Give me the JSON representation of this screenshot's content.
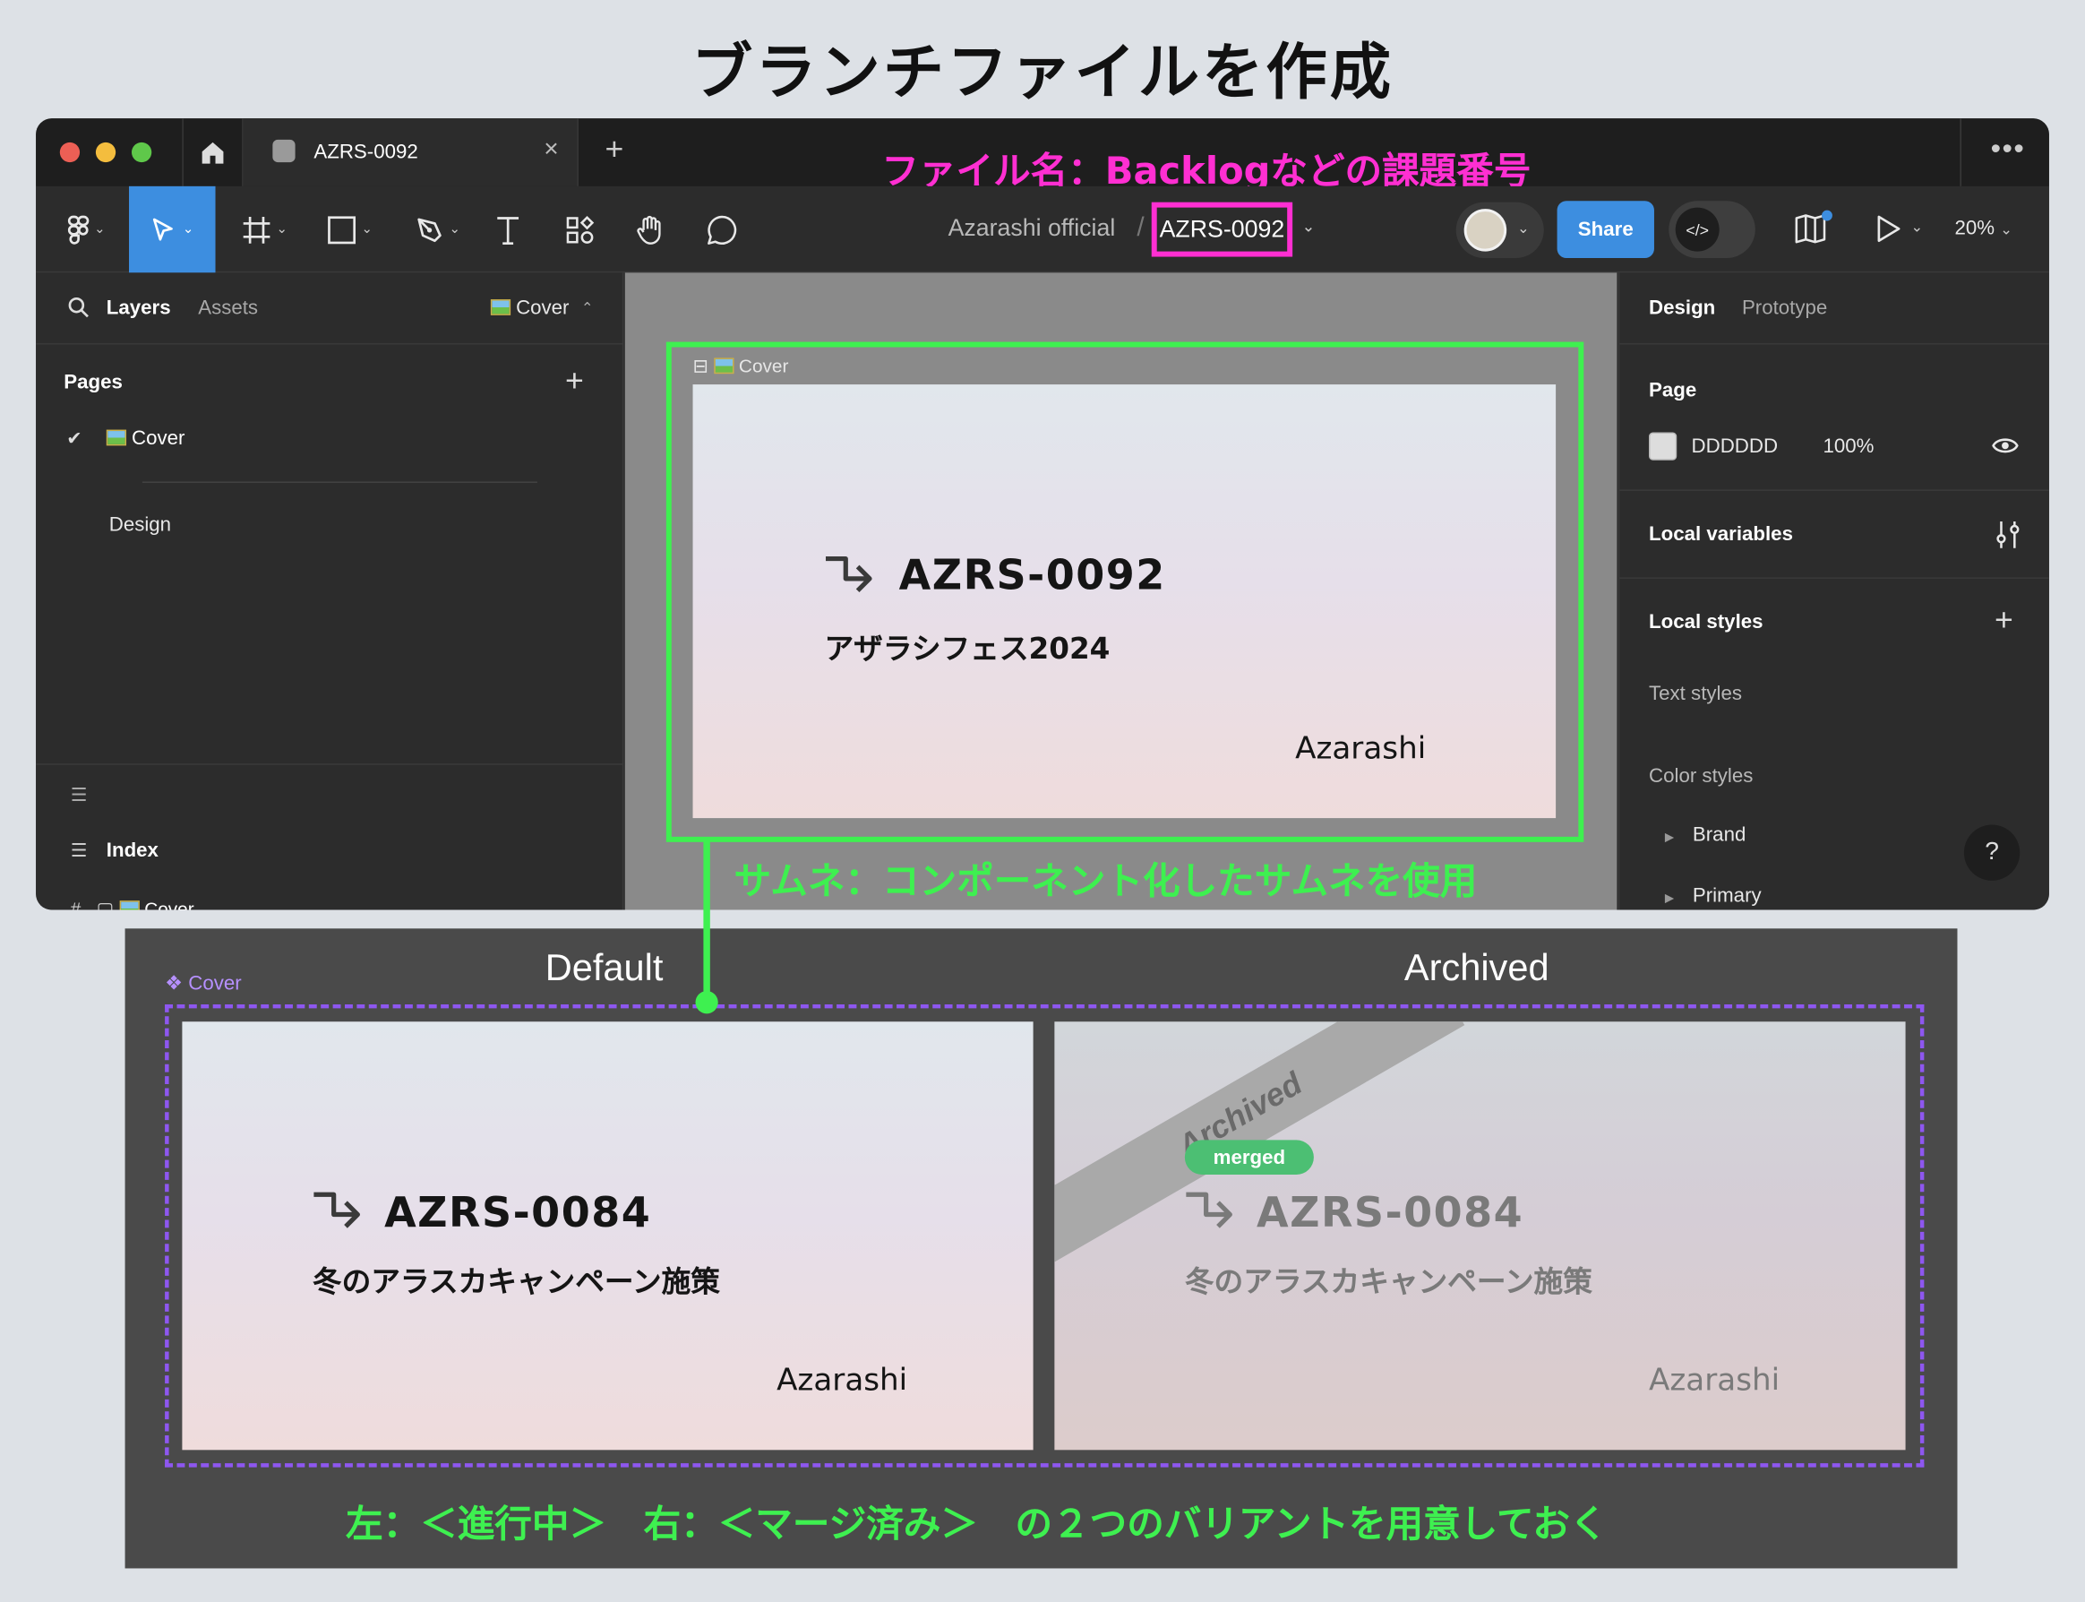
{
  "heading": "ブランチファイルを作成",
  "annotations": {
    "file_name": "ファイル名：Backlogなどの課題番号",
    "thumbnail": "サムネ：コンポーネント化したサムネを使用",
    "variants": "左：＜進行中＞　右：＜マージ済み＞　の２つのバリアントを用意しておく"
  },
  "titlebar": {
    "tab_label": "AZRS-0092",
    "tab_close": "×",
    "new_tab": "+",
    "more": "•••"
  },
  "toolbar": {
    "team": "Azarashi official",
    "separator": "/",
    "file_name": "AZRS-0092",
    "share_label": "Share",
    "dev_mode_icon": "</>",
    "zoom": "20%"
  },
  "left_panel": {
    "layers_tab": "Layers",
    "assets_tab": "Assets",
    "current_page": "Cover",
    "pages_heading": "Pages",
    "add": "+",
    "pages": [
      {
        "label": "Cover",
        "active": true
      },
      {
        "label": "Design",
        "active": false
      }
    ],
    "index_label": "Index",
    "cover_layer": "Cover"
  },
  "canvas": {
    "frame_label": "Cover",
    "thumbnail": {
      "id": "AZRS-0092",
      "title": "アザラシフェス2024",
      "brand": "Azarashi"
    }
  },
  "right_panel": {
    "design_tab": "Design",
    "prototype_tab": "Prototype",
    "page_heading": "Page",
    "page_color": "DDDDDD",
    "page_opacity": "100%",
    "local_variables": "Local variables",
    "local_styles": "Local styles",
    "add": "+",
    "text_styles": "Text styles",
    "color_styles": "Color styles",
    "color_style_groups": [
      "Brand",
      "Primary"
    ],
    "help": "?"
  },
  "component": {
    "label": "Cover",
    "default_heading": "Default",
    "archived_heading": "Archived",
    "default_card": {
      "id": "AZRS-0084",
      "title": "冬のアラスカキャンペーン施策",
      "brand": "Azarashi"
    },
    "archived_card": {
      "ribbon": "Archived",
      "badge": "merged",
      "id": "AZRS-0084",
      "title": "冬のアラスカキャンペーン施策",
      "brand": "Azarashi"
    }
  },
  "colors": {
    "figma_blue": "#3d8ee0",
    "annotation_magenta": "#ff2fd2",
    "annotation_green": "#3ef050",
    "variant_outline": "#8e57f0",
    "merged_badge": "#4cbf73"
  }
}
